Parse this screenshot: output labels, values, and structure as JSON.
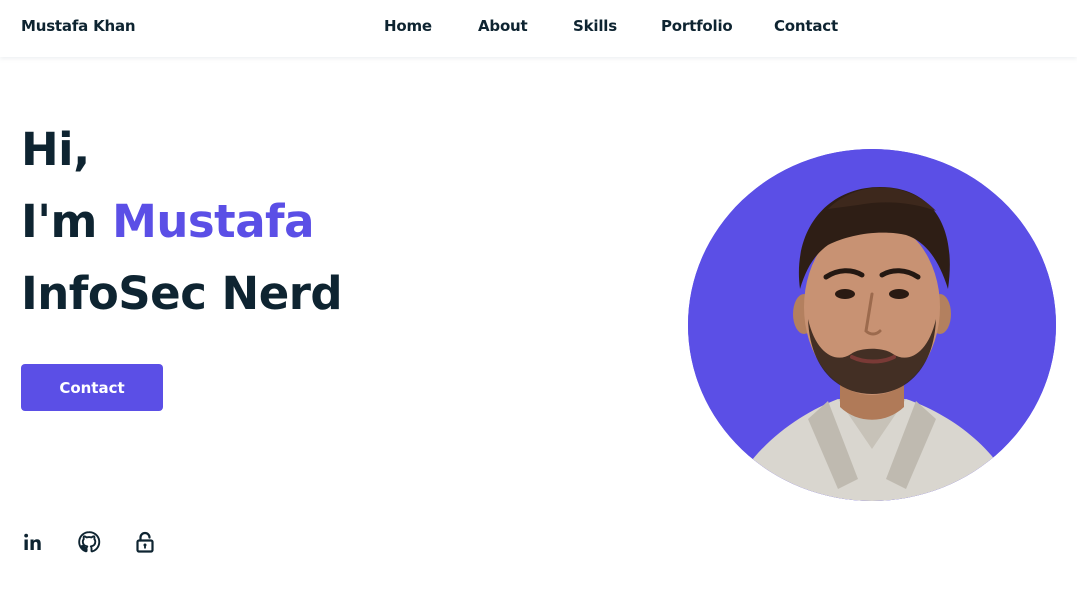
{
  "header": {
    "logo": "Mustafa Khan",
    "nav": [
      {
        "label": "Home"
      },
      {
        "label": "About"
      },
      {
        "label": "Skills"
      },
      {
        "label": "Portfolio"
      },
      {
        "label": "Contact"
      }
    ]
  },
  "hero": {
    "line1": "Hi,",
    "line2_prefix": "I'm ",
    "line2_name": "Mustafa",
    "line3": "InfoSec Nerd",
    "contact_button": "Contact"
  },
  "social": [
    {
      "icon": "linkedin-icon"
    },
    {
      "icon": "github-icon"
    },
    {
      "icon": "lock-icon"
    }
  ],
  "colors": {
    "accent": "#5b4fe6",
    "text": "#0e2431",
    "background": "#ffffff"
  }
}
